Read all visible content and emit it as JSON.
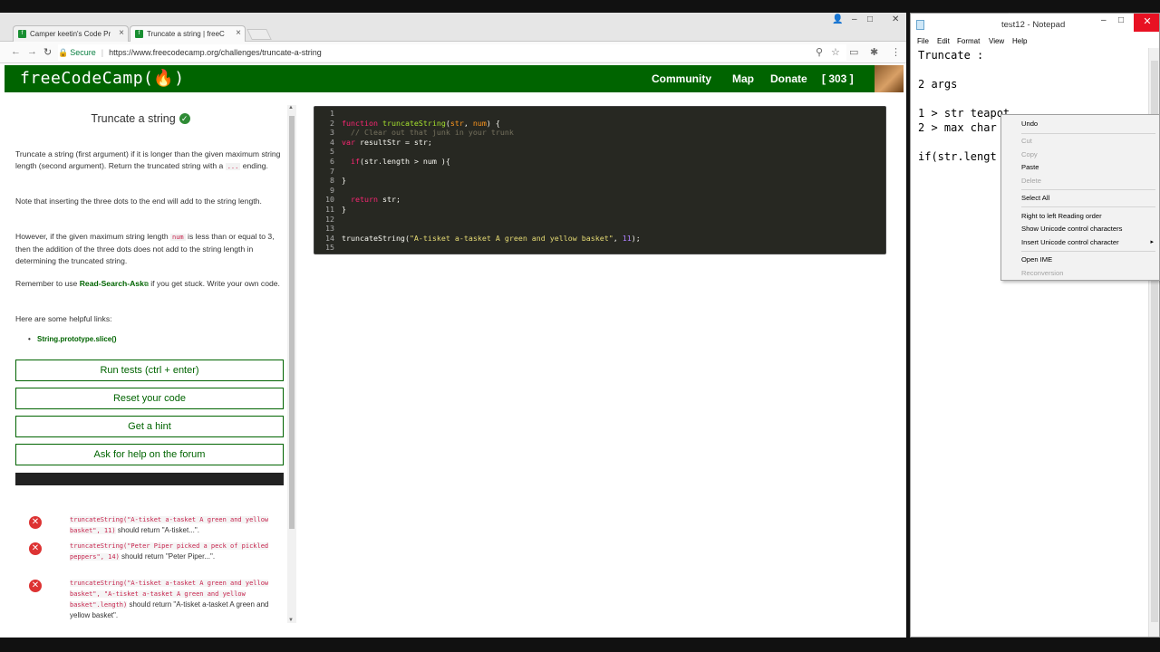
{
  "browser": {
    "tabs": [
      {
        "title": "Camper keetin's Code Pr",
        "close": "×"
      },
      {
        "title": "Truncate a string | freeC",
        "close": "×"
      }
    ],
    "omnibox": {
      "lock": "🔒",
      "secure": "Secure",
      "url": "https://www.freecodecamp.org/challenges/truncate-a-string"
    }
  },
  "fcc": {
    "logo": "freeCodeCamp(🔥)",
    "nav": [
      "Community",
      "Map",
      "Donate",
      "[ 303 ]"
    ]
  },
  "challenge": {
    "title": "Truncate a string",
    "check": "✓",
    "p1a": "Truncate a string (first argument) if it is longer than the given maximum string length (second argument). Return the truncated string with a ",
    "p1code": "...",
    "p1b": " ending.",
    "p2": "Note that inserting the three dots to the end will add to the string length.",
    "p3a": "However, if the given maximum string length ",
    "p3code": "num",
    "p3b": " is less than or equal to 3, then the addition of the three dots does not add to the string length in determining the truncated string.",
    "p4a": "Remember to use ",
    "p4link": "Read-Search-Ask",
    "p4b": " if you get stuck. Write your own code.",
    "p5": "Here are some helpful links:",
    "helpful_link": "String.prototype.slice()",
    "buttons": {
      "run": "Run tests (ctrl + enter)",
      "reset": "Reset your code",
      "hint": "Get a hint",
      "forum": "Ask for help on the forum"
    },
    "tests": [
      {
        "icon": "✕",
        "code": "truncateString(\"A-tisket a-tasket A green and yellow basket\", 11)",
        "text": " should return \"A-tisket...\"."
      },
      {
        "icon": "✕",
        "code": "truncateString(\"Peter Piper picked a peck of pickled peppers\", 14)",
        "text": " should return \"Peter Piper...\"."
      },
      {
        "icon": "✕",
        "code": "truncateString(\"A-tisket a-tasket A green and yellow basket\", \"A-tisket a-tasket A green and yellow basket\".length)",
        "text": " should return \"A-tisket a-tasket A green and yellow basket\"."
      }
    ]
  },
  "editor": {
    "line_numbers": [
      "1",
      "2",
      "3",
      "4",
      "5",
      "6",
      "7",
      "8",
      "9",
      "10",
      "11",
      "12",
      "13",
      "14",
      "15"
    ],
    "l2_kw": "function",
    "l2_fn": "truncateString",
    "l2_p1": "(",
    "l2_a1": "str",
    "l2_p2": ", ",
    "l2_a2": "num",
    "l2_p3": ") {",
    "l3_cm": "  // Clear out that junk in your trunk",
    "l4_kw": "var",
    "l4_rest": " resultStr = str;",
    "l6_indent": "  ",
    "l6_kw": "if",
    "l6_rest": "(str.length > num ){",
    "l8": "}",
    "l10_indent": "  ",
    "l10_kw": "return",
    "l10_rest": " str;",
    "l11": "}",
    "l14_fn": "truncateString",
    "l14_p1": "(",
    "l14_str": "\"A-tisket a-tasket A green and yellow basket\"",
    "l14_p2": ", ",
    "l14_num": "11",
    "l14_p3": ");"
  },
  "notepad": {
    "title": "test12 - Notepad",
    "menu": [
      "File",
      "Edit",
      "Format",
      "View",
      "Help"
    ],
    "text": "Truncate :\n\n2 args\n\n1 > str teapot\n2 > max char\n\nif(str.lengt",
    "close": "✕"
  },
  "context_menu": {
    "undo": "Undo",
    "cut": "Cut",
    "copy": "Copy",
    "paste": "Paste",
    "delete": "Delete",
    "select_all": "Select All",
    "rtl": "Right to left Reading order",
    "show_unicode": "Show Unicode control characters",
    "insert_unicode": "Insert Unicode control character",
    "open_ime": "Open IME",
    "reconversion": "Reconversion"
  },
  "icons": {
    "back": "←",
    "forward": "→",
    "reload": "↻",
    "search": "⚲",
    "star": "☆",
    "cast": "▭",
    "menu": "⋮",
    "win_min": "–",
    "win_max": "□",
    "win_close": "✕",
    "user": "👤",
    "external": "⧉",
    "submenu": "▸"
  },
  "colors": {
    "fcc_green": "#006400",
    "editor_bg": "#272822",
    "fail_red": "#dd3333"
  }
}
